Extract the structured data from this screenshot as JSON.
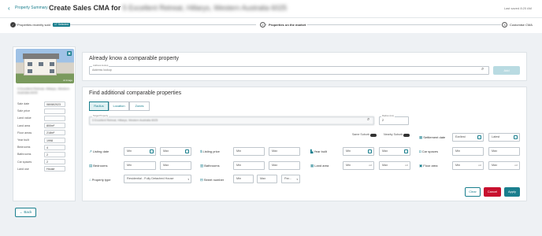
{
  "header": {
    "breadcrumb": "Property Summary",
    "title_prefix": "Create Sales CMA for",
    "title_address": "5 Excellent Retreat, Hillarys, Western Australia 6025",
    "last_saved": "Last saved 8:20 AM"
  },
  "steps": [
    {
      "number": "1",
      "label": "Properties recently sold",
      "badge": "17 Selected"
    },
    {
      "number": "2",
      "label": "Properties on the market"
    },
    {
      "number": "3",
      "label": "Customise CMA"
    }
  ],
  "subject": {
    "address": "5 Excellent Retreat, Hillarys, Western Australia 6025",
    "photo_tag": "Ai Image",
    "fields": [
      {
        "label": "Sale date",
        "value": "08/08/2023"
      },
      {
        "label": "Sale price",
        "value": ""
      },
      {
        "label": "Land value",
        "value": ""
      },
      {
        "label": "Land area",
        "value": "800m²"
      },
      {
        "label": "Floor areas",
        "value": "218m²"
      },
      {
        "label": "Year built",
        "value": "1998"
      },
      {
        "label": "Bedrooms",
        "value": "4"
      },
      {
        "label": "Bathrooms",
        "value": "2"
      },
      {
        "label": "Car spaces",
        "value": "2"
      },
      {
        "label": "Land use",
        "value": "House"
      }
    ]
  },
  "known": {
    "title": "Already know a comparable property",
    "field_label": "Address lookup",
    "placeholder": "Address lookup",
    "add_label": "Add"
  },
  "find": {
    "title": "Find additional comparable properties",
    "tabs": [
      "Radius",
      "Location",
      "Zones"
    ],
    "target_label": "Target Property",
    "target_value": "5 Excellent Retreat, Hillarys, Western Australia 6025",
    "radius_label": "Radius (km)",
    "radius_value": "2",
    "same_suburb": "Same Suburb",
    "nearby_suburb": "Nearby Suburb",
    "settlement_label": "Settlement date",
    "earliest": "Earliest",
    "latest": "Latest",
    "filters": {
      "listing_date": "Listing date",
      "listing_price": "Listing price",
      "year_built": "Year built",
      "car_spaces": "Car spaces",
      "bedrooms": "Bedrooms",
      "bathrooms": "Bathrooms",
      "land_area": "Land area",
      "floor_area": "Floor area",
      "property_type": "Property type",
      "street_number": "Street number"
    },
    "min": "Min",
    "max": "Max",
    "unit": "m²",
    "property_type_value": "Residential - Fully Detached House",
    "parity_value": "Par...",
    "clear": "Clear",
    "cancel": "Cancel",
    "apply": "Apply"
  },
  "back": "Back",
  "colors": {
    "accent": "#1a7f8e",
    "cancel": "#c8102e"
  }
}
